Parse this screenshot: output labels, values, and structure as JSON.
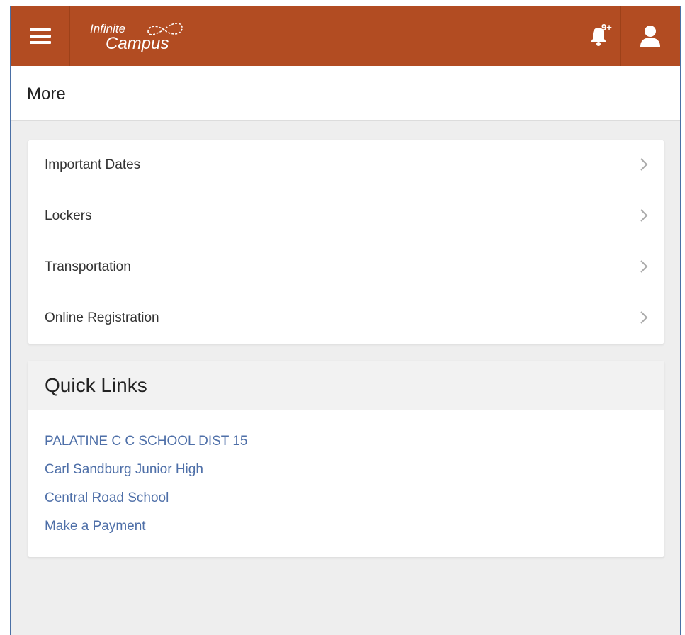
{
  "header": {
    "brand_line1": "Infinite",
    "brand_line2": "Campus",
    "notification_count": "9+",
    "colors": {
      "bar": "#b24c22",
      "link": "#4e6fa8"
    },
    "icons": [
      "menu-icon",
      "bell-icon",
      "user-icon"
    ]
  },
  "page": {
    "title": "More"
  },
  "menu": {
    "items": [
      {
        "label": "Important Dates"
      },
      {
        "label": "Lockers"
      },
      {
        "label": "Transportation"
      },
      {
        "label": "Online Registration"
      }
    ]
  },
  "quick_links": {
    "title": "Quick Links",
    "links": [
      {
        "label": "PALATINE C C SCHOOL DIST 15"
      },
      {
        "label": "Carl Sandburg Junior High"
      },
      {
        "label": "Central Road School"
      },
      {
        "label": "Make a Payment"
      }
    ]
  }
}
